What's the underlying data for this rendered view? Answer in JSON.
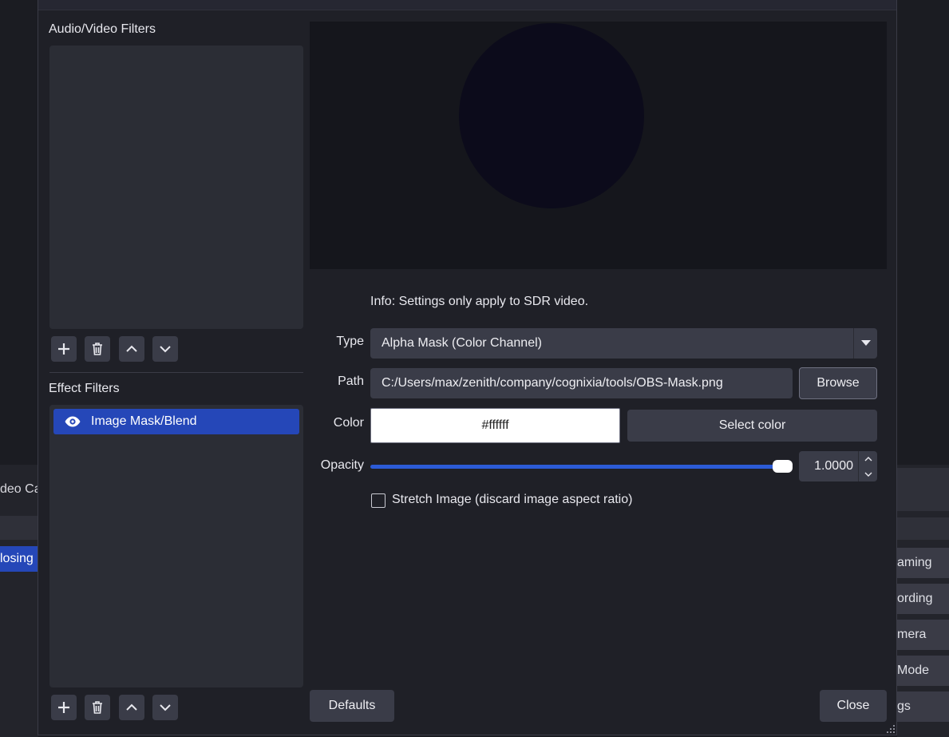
{
  "background": {
    "left_dock_label": "deo Ca",
    "left_dock_selected": "losing",
    "right_dock_buttons": [
      "aming",
      "ording",
      "mera",
      "Mode",
      "gs"
    ]
  },
  "dialog": {
    "audio_video_title": "Audio/Video Filters",
    "effect_title": "Effect Filters",
    "effect_filters": [
      {
        "name": "Image Mask/Blend",
        "visible": true,
        "selected": true
      }
    ],
    "info_text": "Info: Settings only apply to SDR video.",
    "type": {
      "label": "Type",
      "value": "Alpha Mask (Color Channel)"
    },
    "path": {
      "label": "Path",
      "value": "C:/Users/max/zenith/company/cognixia/tools/OBS-Mask.png",
      "browse_label": "Browse"
    },
    "color": {
      "label": "Color",
      "value": "#ffffff",
      "select_label": "Select color"
    },
    "opacity": {
      "label": "Opacity",
      "value": "1.0000",
      "level": 1.0
    },
    "stretch": {
      "label": "Stretch Image (discard image aspect ratio)",
      "checked": false
    },
    "defaults_label": "Defaults",
    "close_label": "Close"
  },
  "colors": {
    "accent": "#2547b8",
    "slider": "#2c5bd6",
    "panel": "#2b2d35",
    "button": "#3a3c48"
  },
  "icons": {
    "add": "plus-icon",
    "remove": "trash-icon",
    "up": "chevron-up-icon",
    "down": "chevron-down-icon",
    "visibility": "eye-icon"
  }
}
